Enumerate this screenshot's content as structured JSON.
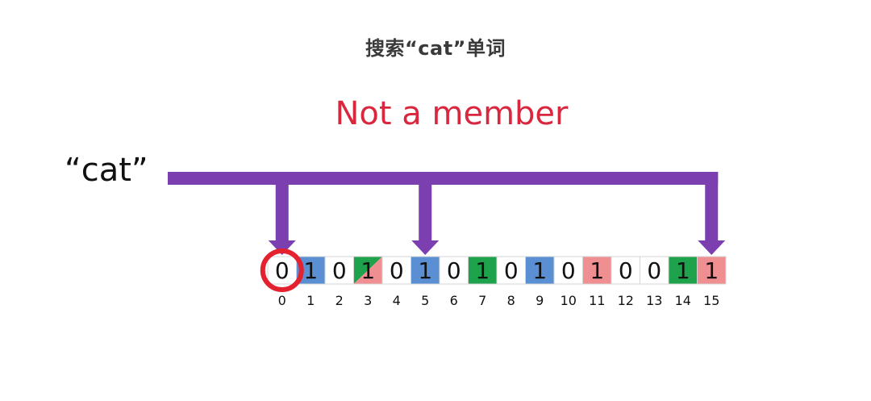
{
  "subtitle": "搜索“cat”单词",
  "result_text": "Not a member",
  "query_word": "“cat”",
  "colors": {
    "arrow": "#7b3fb0",
    "result": "#d9273f",
    "circle": "#e4212f",
    "blue": "#5b8fd4",
    "green": "#1fa24c",
    "pink": "#ef8f92"
  },
  "bit_array": {
    "cells": [
      {
        "index": "0",
        "bit": "0",
        "fill": "white"
      },
      {
        "index": "1",
        "bit": "1",
        "fill": "blue"
      },
      {
        "index": "2",
        "bit": "0",
        "fill": "white"
      },
      {
        "index": "3",
        "bit": "1",
        "fill": "green-pink"
      },
      {
        "index": "4",
        "bit": "0",
        "fill": "white"
      },
      {
        "index": "5",
        "bit": "1",
        "fill": "blue"
      },
      {
        "index": "6",
        "bit": "0",
        "fill": "white"
      },
      {
        "index": "7",
        "bit": "1",
        "fill": "green"
      },
      {
        "index": "8",
        "bit": "0",
        "fill": "white"
      },
      {
        "index": "9",
        "bit": "1",
        "fill": "blue"
      },
      {
        "index": "10",
        "bit": "0",
        "fill": "white"
      },
      {
        "index": "11",
        "bit": "1",
        "fill": "pink"
      },
      {
        "index": "12",
        "bit": "0",
        "fill": "white"
      },
      {
        "index": "13",
        "bit": "0",
        "fill": "white"
      },
      {
        "index": "14",
        "bit": "1",
        "fill": "green"
      },
      {
        "index": "15",
        "bit": "1",
        "fill": "pink"
      }
    ],
    "hash_targets": [
      0,
      5,
      15
    ],
    "highlighted_index": 0
  }
}
